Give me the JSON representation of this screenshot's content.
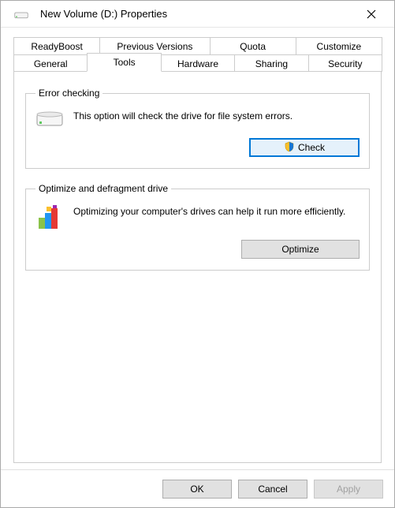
{
  "window": {
    "title": "New Volume (D:) Properties"
  },
  "tabs": {
    "row1": [
      "ReadyBoost",
      "Previous Versions",
      "Quota",
      "Customize"
    ],
    "row2": [
      "General",
      "Tools",
      "Hardware",
      "Sharing",
      "Security"
    ],
    "active": "Tools"
  },
  "error_checking": {
    "legend": "Error checking",
    "description": "This option will check the drive for file system errors.",
    "button_label": "Check",
    "icon": "shield-icon"
  },
  "optimize": {
    "legend": "Optimize and defragment drive",
    "description": "Optimizing your computer's drives can help it run more efficiently.",
    "button_label": "Optimize",
    "icon": "defrag-icon"
  },
  "dialog_buttons": {
    "ok": "OK",
    "cancel": "Cancel",
    "apply": "Apply"
  }
}
